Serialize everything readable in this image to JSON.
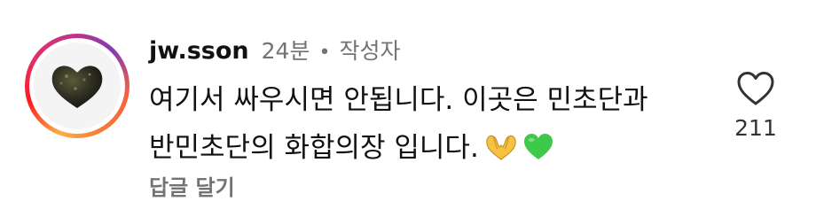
{
  "comment": {
    "username": "jw.sson",
    "time": "24분",
    "separator": "•",
    "author_badge": "작성자",
    "text_line_1": "여기서 싸우시면 안됩니다. 이곳은 민초단과",
    "text_line_2": "반민초단의 화합의장 입니다.",
    "emojis": [
      "heart-hands-emoji",
      "green-heart-emoji"
    ],
    "reply_label": "답글 달기",
    "like_count": "211",
    "like_icon": "heart-outline-icon",
    "colors": {
      "primary_text": "#111111",
      "secondary_text": "#737373",
      "green_heart": "#3ec94a",
      "heart_hands": "#f5c242"
    }
  }
}
